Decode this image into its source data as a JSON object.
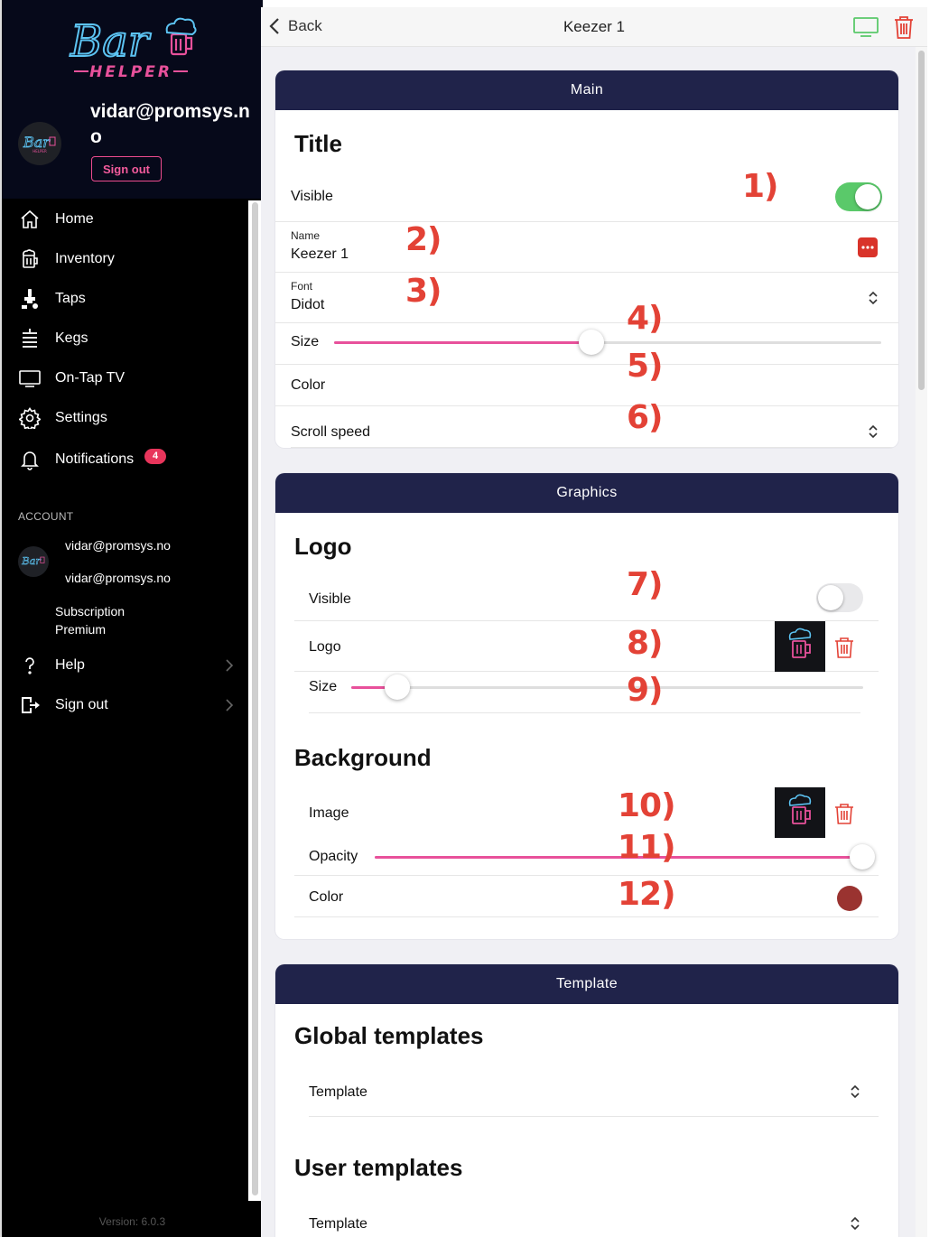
{
  "app": {
    "logo_word": "Bar",
    "logo_sub": "HELPER",
    "colors": {
      "brand_dark": "#20234a",
      "accent_pink": "#e8519b",
      "logo_blue": "#5cc3f2",
      "marker_red": "#e34236",
      "toggle_green": "#5ac96a"
    }
  },
  "sidebar": {
    "user_email": "vidar@promsys.no",
    "signout_label": "Sign out",
    "nav": [
      {
        "label": "Home",
        "icon": "home-icon"
      },
      {
        "label": "Inventory",
        "icon": "beer-mug-icon"
      },
      {
        "label": "Taps",
        "icon": "tap-icon"
      },
      {
        "label": "Kegs",
        "icon": "keg-icon"
      },
      {
        "label": "On-Tap TV",
        "icon": "tv-icon"
      },
      {
        "label": "Settings",
        "icon": "gear-icon"
      },
      {
        "label": "Notifications",
        "icon": "bell-icon",
        "badge": "4"
      }
    ],
    "account_header": "ACCOUNT",
    "account_email_1": "vidar@promsys.no",
    "account_email_2": "vidar@promsys.no",
    "subscription_label": "Subscription",
    "subscription_value": "Premium",
    "help_label": "Help",
    "signout_nav_label": "Sign out",
    "version": "Version: 6.0.3"
  },
  "topbar": {
    "back_label": "Back",
    "title": "Keezer 1"
  },
  "main_card": {
    "header": "Main",
    "section_title": "Title",
    "visible_label": "Visible",
    "visible_on": true,
    "name_caption": "Name",
    "name_value": "Keezer 1",
    "font_caption": "Font",
    "font_value": "Didot",
    "size_label": "Size",
    "size_value": 0.47,
    "color_label": "Color",
    "scroll_label": "Scroll speed"
  },
  "graphics_card": {
    "header": "Graphics",
    "logo_title": "Logo",
    "logo_visible_label": "Visible",
    "logo_visible_on": false,
    "logo_label": "Logo",
    "logo_size_label": "Size",
    "logo_size_value": 0.09,
    "background_title": "Background",
    "image_label": "Image",
    "opacity_label": "Opacity",
    "opacity_value": 1.0,
    "color_label": "Color",
    "color_value": "#9a3330"
  },
  "template_card": {
    "header": "Template",
    "global_title": "Global templates",
    "global_select": "Template",
    "user_title": "User templates",
    "user_select": "Template"
  },
  "markers": [
    "1)",
    "2)",
    "3)",
    "4)",
    "5)",
    "6)",
    "7)",
    "8)",
    "9)",
    "10)",
    "11)",
    "12)"
  ]
}
